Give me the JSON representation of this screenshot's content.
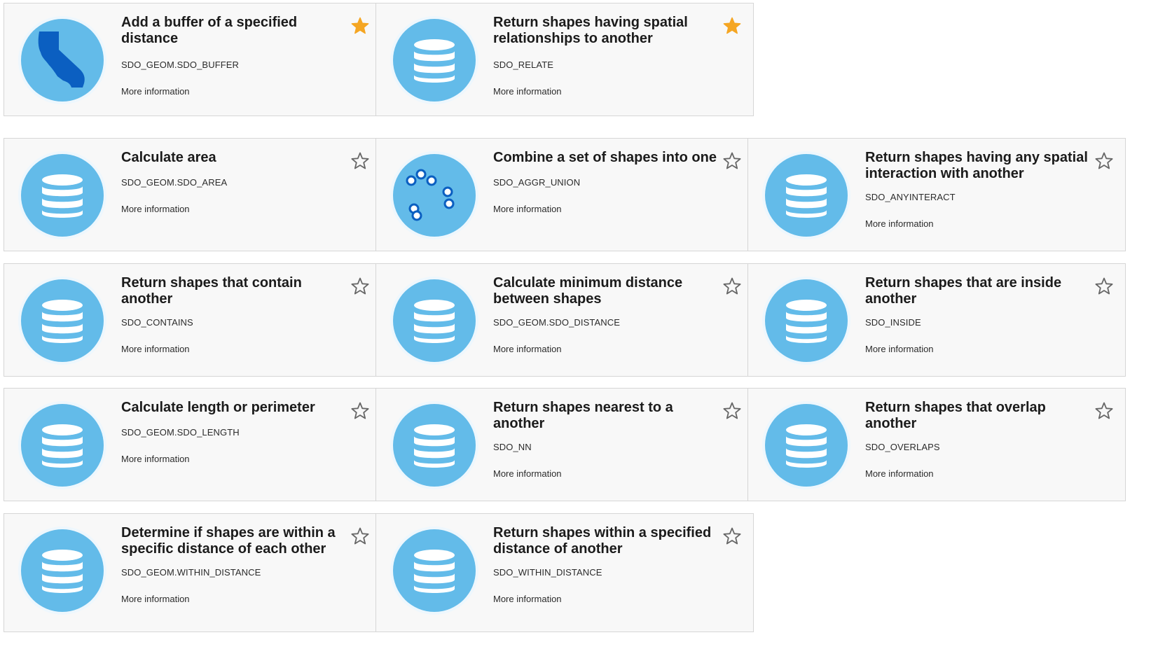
{
  "more_label": "More information",
  "colors": {
    "icon_bg": "#63bbe9",
    "star_active": "#f5a623",
    "star_inactive": "#666666",
    "map_fill": "#0b5fc1"
  },
  "cards": [
    {
      "title": "Add a buffer of a specified distance",
      "code": "SDO_GEOM.SDO_BUFFER",
      "icon": "california-map-icon",
      "favorite": true
    },
    {
      "title": "Return shapes having spatial relationships to another",
      "code": "SDO_RELATE",
      "icon": "database-icon",
      "favorite": true
    },
    {
      "title": "Calculate area",
      "code": "SDO_GEOM.SDO_AREA",
      "icon": "database-icon",
      "favorite": false
    },
    {
      "title": "Combine a set of shapes into one",
      "code": "SDO_AGGR_UNION",
      "icon": "point-cluster-icon",
      "favorite": false
    },
    {
      "title": "Return shapes having any spatial interaction with another",
      "code": "SDO_ANYINTERACT",
      "icon": "database-icon",
      "favorite": false
    },
    {
      "title": "Return shapes that contain another",
      "code": "SDO_CONTAINS",
      "icon": "database-icon",
      "favorite": false
    },
    {
      "title": "Calculate minimum distance between shapes",
      "code": "SDO_GEOM.SDO_DISTANCE",
      "icon": "database-icon",
      "favorite": false
    },
    {
      "title": "Return shapes that are inside another",
      "code": "SDO_INSIDE",
      "icon": "database-icon",
      "favorite": false
    },
    {
      "title": "Calculate length or perimeter",
      "code": "SDO_GEOM.SDO_LENGTH",
      "icon": "database-icon",
      "favorite": false
    },
    {
      "title": "Return shapes nearest to a another",
      "code": "SDO_NN",
      "icon": "database-icon",
      "favorite": false
    },
    {
      "title": "Return shapes that overlap another",
      "code": "SDO_OVERLAPS",
      "icon": "database-icon",
      "favorite": false
    },
    {
      "title": "Determine if shapes are within a specific distance of each other",
      "code": "SDO_GEOM.WITHIN_DISTANCE",
      "icon": "database-icon",
      "favorite": false
    },
    {
      "title": "Return shapes within a specified distance of another",
      "code": "SDO_WITHIN_DISTANCE",
      "icon": "database-icon",
      "favorite": false
    }
  ]
}
